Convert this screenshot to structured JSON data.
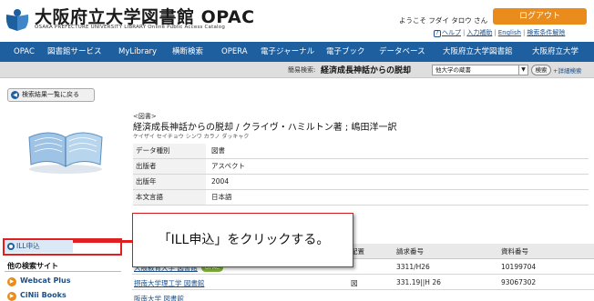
{
  "header": {
    "brand_title": "大阪府立大学図書館 OPAC",
    "brand_subtitle": "OSAKA PREFECTURE UNIVERSITY LIBRARY Online Public Access Catalog",
    "welcome": "ようこそ フダイ タロウ さん",
    "logout_label": "ログアウト",
    "help_label": "ヘルプ",
    "input_help_label": "入力補助",
    "english_label": "English",
    "search_conditions_label": "検索条件解除"
  },
  "nav": {
    "items": [
      "OPAC",
      "図書館サービス",
      "MyLibrary",
      "横断検索",
      "OPERA",
      "電子ジャーナル",
      "電子ブック",
      "データベース",
      "大阪府立大学図書館",
      "大阪府立大学"
    ]
  },
  "quick_search": {
    "label": "簡易検索:",
    "value": "経済成長神話からの脱却",
    "scope": "他大学の蔵書",
    "button": "検索",
    "advanced": "+詳細検索"
  },
  "back_button": "検索結果一覧に戻る",
  "bib": {
    "type_tag": "<図書>",
    "title": "経済成長神話からの脱却 / クライヴ・ハミルトン著 ; 嶋田洋一訳",
    "kana": "ケイザイ セイチョウ シンワ カラノ ダッキャク",
    "rows": [
      {
        "key": "データ種別",
        "value": "図書"
      },
      {
        "key": "出版者",
        "value": "アスペクト"
      },
      {
        "key": "出版年",
        "value": "2004"
      },
      {
        "key": "本文言語",
        "value": "日本語"
      }
    ]
  },
  "sidebar": {
    "ill_label": "ILL申込",
    "other_sites_heading": "他の検索サイト",
    "sites": [
      {
        "label": "Webcat Plus",
        "icon": "webcat-icon"
      },
      {
        "label": "CiNii Books",
        "icon": "cinii-icon"
      }
    ]
  },
  "holdings": {
    "headers": [
      "配置",
      "請求番号",
      "資料番号"
    ],
    "rows": [
      {
        "library": "大阪教育大学 図書館",
        "badge": "OPAC",
        "location": "",
        "call_number": "3311/H26",
        "item_id": "10199704"
      },
      {
        "library": "摂南大学理工学 図書館",
        "badge": "",
        "location": "図",
        "call_number": "331.19||H 26",
        "item_id": "93067302"
      },
      {
        "library": "阪南大学 図書館",
        "badge": "",
        "location": "",
        "call_number": "",
        "item_id": ""
      }
    ]
  },
  "callout": {
    "text": "「ILL申込」をクリックする。"
  },
  "colors": {
    "nav_blue": "#1d5f9f",
    "logout_orange": "#e98c1c",
    "highlight_red": "#e02020",
    "opac_badge_green": "#7fb03a"
  }
}
